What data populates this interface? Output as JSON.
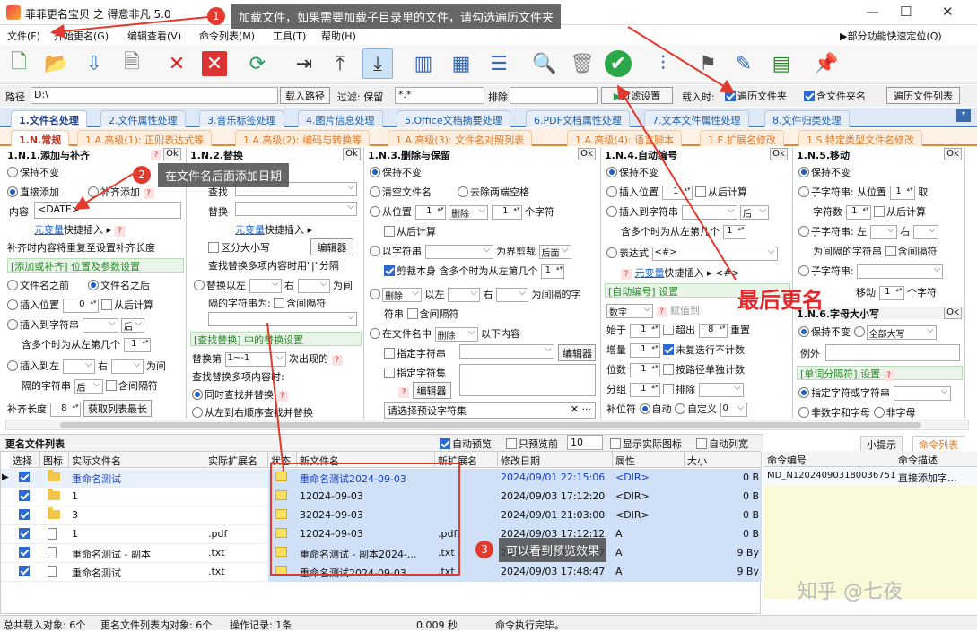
{
  "app": {
    "title": "菲菲更名宝贝 之 得意非凡 5.0"
  },
  "menu": [
    "文件(F)",
    "开始更名(G)",
    "编辑查看(V)",
    "命令列表(M)",
    "工具(T)",
    "帮助(H)"
  ],
  "menu_right": "▶部分功能快速定位(Q)",
  "path": {
    "label": "路径",
    "value": "D:\\",
    "load_button": "载入路径",
    "filter_label": "过滤: 保留",
    "filter_value": "*.*",
    "exclude_label": "排除",
    "filter_settings": "过滤设置",
    "load_when": "载入时:",
    "traverse_folder": "遍历文件夹",
    "include_folder_name": "含文件夹名",
    "traverse_list": "遍历文件列表"
  },
  "tabs1": [
    "1.文件名处理",
    "2.文件属性处理",
    "3.音乐标签处理",
    "4.图片信息处理",
    "5.Office文档摘要处理",
    "6.PDF文档属性处理",
    "7.文本文件属性处理",
    "8.文件归类处理"
  ],
  "tabs2": [
    "1.N.常规",
    "1.A.高级(1): 正则表达式等",
    "1.A.高级(2): 编码与转换等",
    "1.A.高级(3): 文件名对照列表",
    "1.A.高级(4): 语言脚本",
    "1.E.扩展名修改",
    "1.S.特定类型文件名修改"
  ],
  "p1": {
    "title": "1.N.1.添加与补齐",
    "ok": "Ok",
    "keep": "保持不变",
    "direct_add": "直接添加",
    "pad_add": "补齐添加",
    "content_label": "内容",
    "content_value": "<DATE>",
    "meta_var": "元变量",
    "quick_insert": "快捷插入 ▸",
    "pad_note": "补齐时内容将重复至设置补齐长度",
    "section": "[添加或补齐] 位置及参数设置",
    "before": "文件名之前",
    "after": "文件名之后",
    "insert_pos": "插入位置",
    "insert_pos_val": "0",
    "from_back": "从后计算",
    "insert_to_str": "插入到字符串",
    "after_dd": "后",
    "multi_note": "含多个时为从左第几个",
    "multi_val": "1",
    "insert_left": "插入到左",
    "right": "右",
    "between": "为间",
    "sep_str": "隔的字符串",
    "after_dd2": "后",
    "include_sep": "含间隔符",
    "pad_len": "补齐长度",
    "pad_len_val": "8",
    "get_max": "获取列表最长"
  },
  "p2": {
    "title": "1.N.2.替换",
    "ok": "Ok",
    "find": "查找",
    "replace": "替换",
    "meta_var": "元变量",
    "quick_insert": "快捷插入 ▸",
    "case": "区分大小写",
    "editor": "编辑器",
    "multi_note": "查找替换多项内容时用\"|\"分隔",
    "replace_left": "替换以左",
    "right": "右",
    "between": "为间",
    "sep": "隔的字符串为:",
    "include_sep": "含间隔符",
    "section": "[查找替换] 中的替换设置",
    "replace_nth": "替换第",
    "nth_val": "1~-1",
    "nth_suffix": "次出现的",
    "multi_note2": "查找替换多项内容时:",
    "sim": "同时查找并替换",
    "seq": "从左到右顺序查找并替换"
  },
  "p3": {
    "title": "1.N.3.删除与保留",
    "ok": "Ok",
    "keep": "保持不变",
    "clear": "清空文件名",
    "trim": "去除两端空格",
    "from_pos": "从位置",
    "from_val": "1",
    "delete": "删除",
    "del_val": "1",
    "chars": "个字符",
    "from_back": "从后计算",
    "by_str": "以字符串",
    "boundary": "为界剪裁",
    "after": "后面",
    "trim_self": "剪裁本身",
    "multi_note": "含多个时为从左第几个",
    "multi_val": "1",
    "delete2": "删除",
    "by_left": "以左",
    "right": "右",
    "between": "为间隔的字",
    "sym": "符串",
    "include_sep": "含间隔符",
    "in_filename": "在文件名中",
    "delete3": "删除",
    "following": "以下内容",
    "specify_str": "指定字符串",
    "editor": "编辑器",
    "specify_set": "指定字符集",
    "editor2": "编辑器",
    "preset": "请选择预设字符集"
  },
  "p4": {
    "title": "1.N.4.自动编号",
    "ok": "Ok",
    "keep": "保持不变",
    "insert_pos": "插入位置",
    "insert_val": "1",
    "from_back": "从后计算",
    "insert_str": "插入到字符串",
    "after": "后",
    "multi_note": "含多个时为从左第几个",
    "multi_val": "1",
    "expr": "表达式",
    "expr_val": "<#>",
    "meta_var": "元变量",
    "quick_insert": "快捷插入 ▸",
    "hash": "<#>",
    "section": "[自动编号] 设置",
    "digits": "数字",
    "assign": "赋值到",
    "start": "始于",
    "start_val": "1",
    "overflow": "超出",
    "over_val": "8",
    "restart": "重置",
    "step": "增量",
    "step_val": "1",
    "no_repeat": "未复迭行不计数",
    "digits_label": "位数",
    "digits_val": "1",
    "by_path": "按路径单独计数",
    "group": "分组",
    "group_val": "1",
    "exclude": "排除",
    "pad": "补位符",
    "auto": "自动",
    "custom": "自定义",
    "custom_val": "0"
  },
  "p5": {
    "title": "1.N.5.移动",
    "ok": "Ok",
    "keep": "保持不变",
    "substr": "子字符串: 从位置",
    "substr_val": "1",
    "take": "取",
    "char_count": "字符数",
    "cc_val": "1",
    "from_back": "从后计算",
    "substr2": "子字符串: 左",
    "right": "右",
    "between_str": "为间隔的字符串",
    "include_sep": "含间隔符",
    "substr3": "子字符串:",
    "move": "移动",
    "move_val": "1",
    "chars": "个字符",
    "case_title": "1.N.6.字母大小写",
    "case_ok": "Ok",
    "keep2": "保持不变",
    "all_upper": "全部大写",
    "except": "例外",
    "word_sec": "[单词分隔符] 设置",
    "specify": "指定字符或字符串",
    "non_digit": "非数字和字母",
    "non_char": "非字母"
  },
  "list": {
    "title": "更名文件列表",
    "auto_preview": "自动预览",
    "preview_first": "只预览前",
    "preview_n": "10",
    "show_icon": "显示实际图标",
    "auto_cols": "自动列宽",
    "headers": [
      "选择",
      "图标",
      "实际文件名",
      "实际扩展名",
      "状态",
      "新文件名",
      "新扩展名",
      "修改日期",
      "属性",
      "大小"
    ],
    "rows": [
      {
        "name": "重命名测试",
        "ext": "",
        "newname": "重命名测试2024-09-03",
        "newext": "",
        "date": "2024/09/01 22:15:06",
        "attr": "<DIR>",
        "size": "0 B",
        "icon": "folder"
      },
      {
        "name": "1",
        "ext": "",
        "newname": "12024-09-03",
        "newext": "",
        "date": "2024/09/03 17:12:20",
        "attr": "<DIR>",
        "size": "0 B",
        "icon": "folder"
      },
      {
        "name": "3",
        "ext": "",
        "newname": "32024-09-03",
        "newext": "",
        "date": "2024/09/01 21:03:00",
        "attr": "<DIR>",
        "size": "0 B",
        "icon": "folder"
      },
      {
        "name": "1",
        "ext": ".pdf",
        "newname": "12024-09-03",
        "newext": ".pdf",
        "date": "2024/09/03 17:12:12",
        "attr": "A",
        "size": "0 B",
        "icon": "file"
      },
      {
        "name": "重命名测试 - 副本",
        "ext": ".txt",
        "newname": "重命名测试 - 副本2024-...",
        "newext": ".txt",
        "date": "2024/09/03 17:48:47",
        "attr": "A",
        "size": "9 By",
        "icon": "file"
      },
      {
        "name": "重命名测试",
        "ext": ".txt",
        "newname": "重命名测试2024-09-03",
        "newext": ".txt",
        "date": "2024/09/03 17:48:47",
        "attr": "A",
        "size": "9 By",
        "icon": "file"
      }
    ]
  },
  "right": {
    "tab_tips": "小提示",
    "tab_cmds": "命令列表",
    "col_id": "命令编号",
    "col_desc": "命令描述",
    "cmd_id": "MD_N120240903180036751",
    "cmd_desc": "直接添加字..."
  },
  "status": {
    "total": "总共载入对象: 6个",
    "in_list": "更名文件列表内对象: 6个",
    "ops": "操作记录: 1条",
    "time": "0.009 秒",
    "done": "命令执行完毕。"
  },
  "annotations": {
    "a1": "加载文件，如果需要加载子目录里的文件，请勾选遍历文件夹",
    "a2": "在文件名后面添加日期",
    "a3": "可以看到预览效果",
    "final": "最后更名",
    "n1": "1",
    "n2": "2",
    "n3": "3"
  },
  "watermark": "知乎 @七夜"
}
